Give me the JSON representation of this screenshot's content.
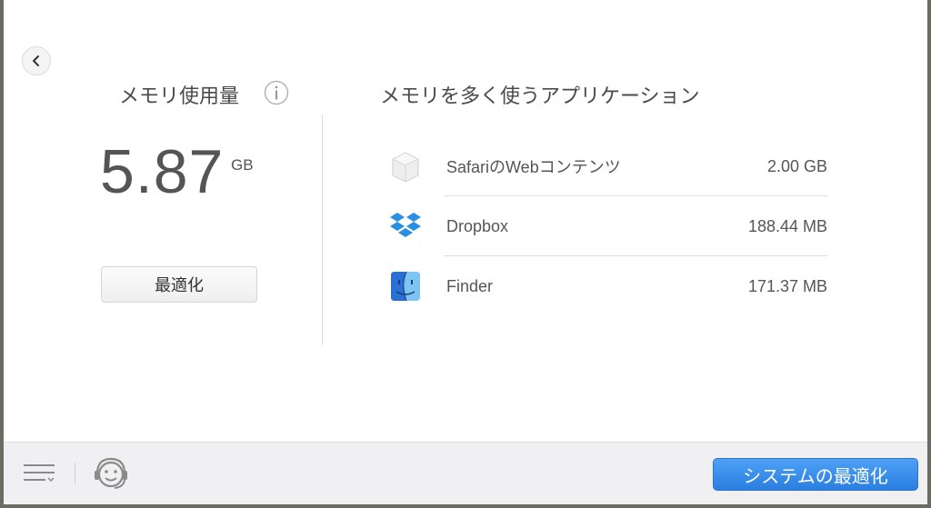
{
  "memory_usage": {
    "title": "メモリ使用量",
    "value": "5.87",
    "unit": "GB",
    "optimize_label": "最適化"
  },
  "top_apps": {
    "title": "メモリを多く使うアプリケーション",
    "items": [
      {
        "name": "SafariのWebコンテンツ",
        "size": "2.00 GB",
        "icon": "safari-web-content-icon"
      },
      {
        "name": "Dropbox",
        "size": "188.44 MB",
        "icon": "dropbox-icon"
      },
      {
        "name": "Finder",
        "size": "171.37 MB",
        "icon": "finder-icon"
      }
    ]
  },
  "bottom_bar": {
    "system_optimize_label": "システムの最適化"
  },
  "colors": {
    "accent": "#2f86e6",
    "dropbox": "#2a8fe0",
    "text": "#555555"
  }
}
